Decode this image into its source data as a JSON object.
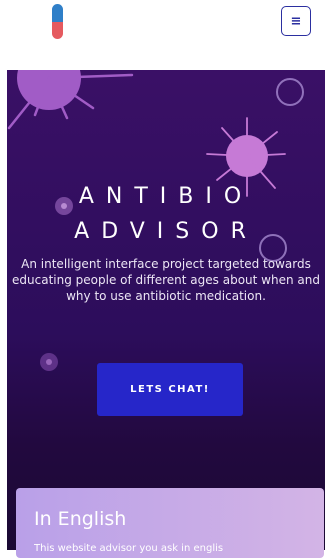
{
  "brand": {
    "logo_icon": "capsule-icon",
    "colors": {
      "capsule_top": "#2f7fc8",
      "capsule_bottom": "#e55a5f"
    }
  },
  "nav": {
    "menu_icon": "hamburger-icon",
    "menu_glyph": "≡"
  },
  "hero": {
    "title_line1": "ANTIBIO",
    "title_line2": "ADVISOR",
    "description": "An intelligent interface project targeted towards educating people of different ages about when and why to use antibiotic medication.",
    "cta_label": "LETS CHAT!",
    "background": "#2c0d5b",
    "cta_color": "#2626c9"
  },
  "card": {
    "title": "In English",
    "text": "This website advisor you ask in englis",
    "background": "#c4a8e8"
  }
}
